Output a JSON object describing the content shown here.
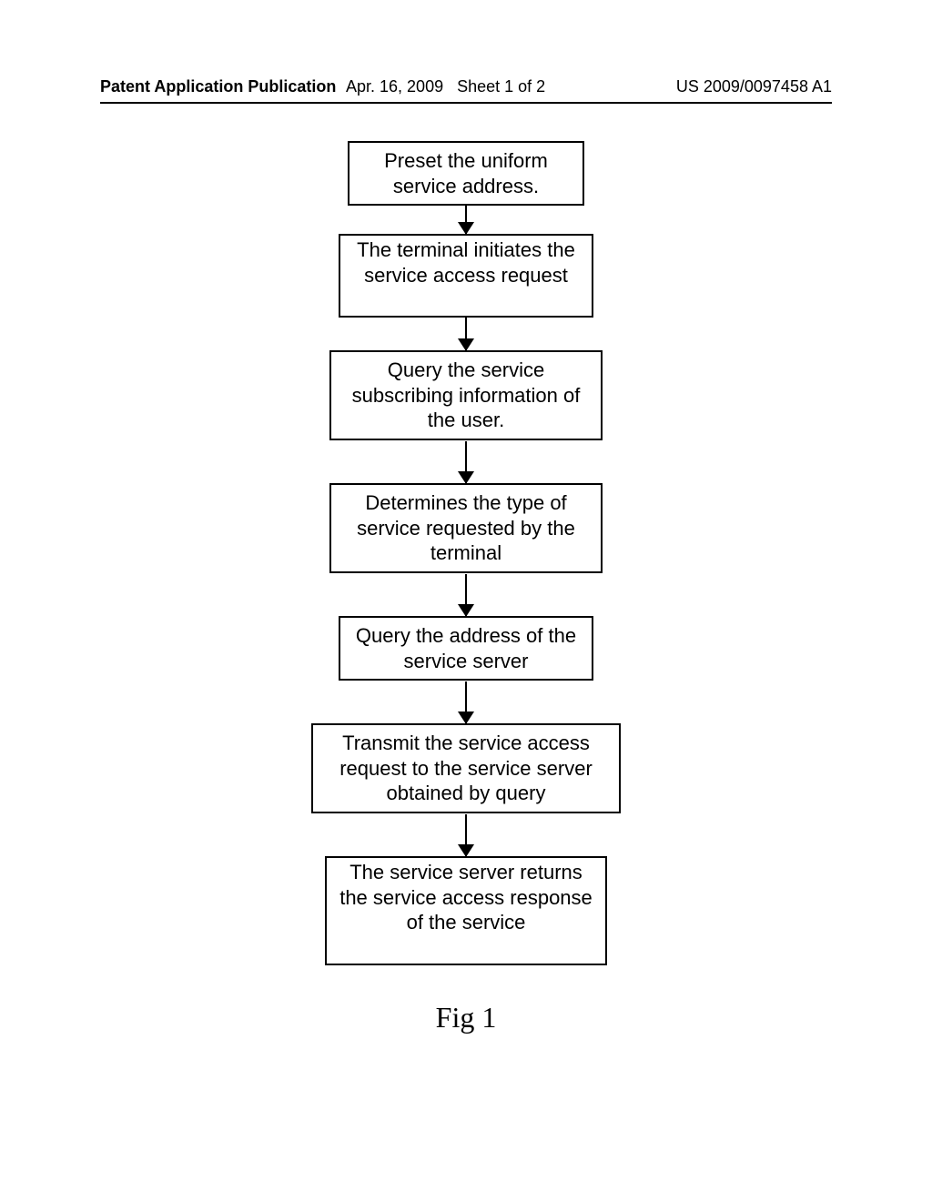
{
  "header": {
    "left": "Patent Application Publication",
    "date": "Apr. 16, 2009",
    "sheet": "Sheet 1 of 2",
    "pubno": "US 2009/0097458 A1"
  },
  "caption": "Fig 1",
  "flow": {
    "steps": [
      "Preset the uniform service address.",
      "The terminal initiates the service access request",
      "Query the service subscribing information of the user.",
      "Determines the type of service requested by the terminal",
      "Query the address of the service server",
      "Transmit the service access request to the service server obtained by query",
      "The service server returns the service access response of the service"
    ]
  },
  "chart_data": {
    "type": "flowchart",
    "direction": "top-to-bottom",
    "nodes": [
      {
        "id": "n1",
        "label": "Preset the uniform service address."
      },
      {
        "id": "n2",
        "label": "The terminal initiates the service access request"
      },
      {
        "id": "n3",
        "label": "Query the service subscribing information of the user."
      },
      {
        "id": "n4",
        "label": "Determines the type of service requested by the terminal"
      },
      {
        "id": "n5",
        "label": "Query the address of the service server"
      },
      {
        "id": "n6",
        "label": "Transmit the service access request to the service server obtained by query"
      },
      {
        "id": "n7",
        "label": "The service server returns the service access response of the service"
      }
    ],
    "edges": [
      {
        "from": "n1",
        "to": "n2"
      },
      {
        "from": "n2",
        "to": "n3"
      },
      {
        "from": "n3",
        "to": "n4"
      },
      {
        "from": "n4",
        "to": "n5"
      },
      {
        "from": "n5",
        "to": "n6"
      },
      {
        "from": "n6",
        "to": "n7"
      }
    ],
    "title": "Fig 1"
  }
}
